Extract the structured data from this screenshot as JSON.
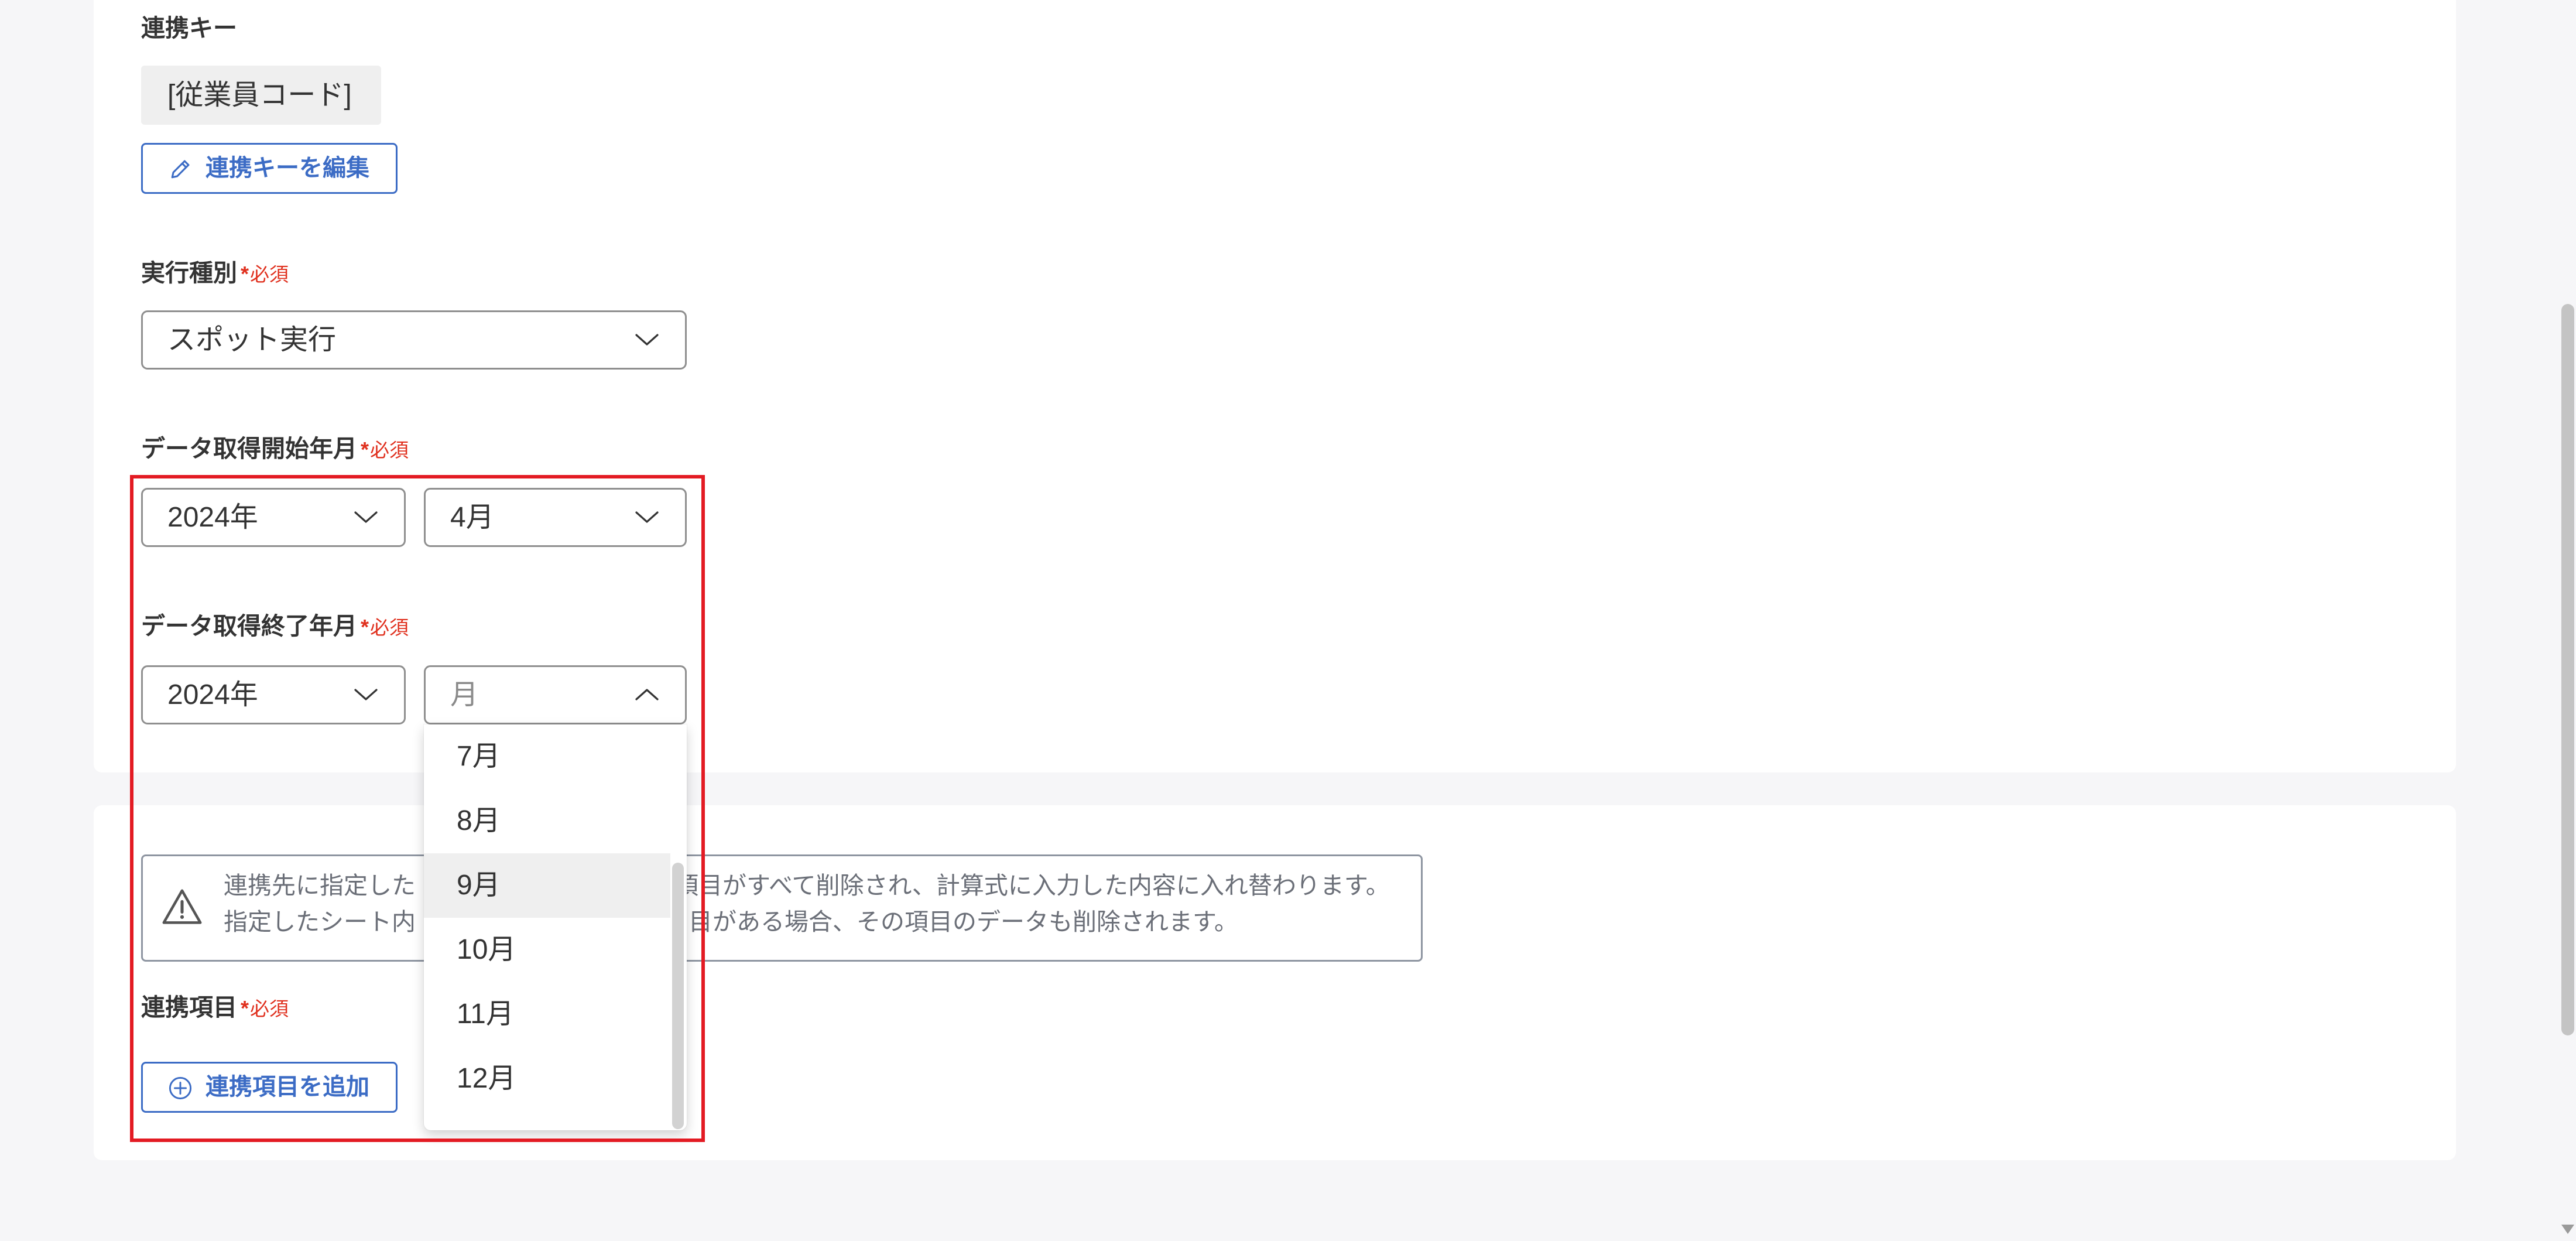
{
  "required": {
    "mark": "*",
    "text": "必須"
  },
  "linkage_key": {
    "label": "連携キー",
    "value": "[従業員コード]",
    "edit_button": "連携キーを編集"
  },
  "execution_type": {
    "label": "実行種別",
    "selected": "スポット実行"
  },
  "start_period": {
    "label": "データ取得開始年月",
    "year": "2024年",
    "month": "4月"
  },
  "end_period": {
    "label": "データ取得終了年月",
    "year": "2024年",
    "month_placeholder": "月",
    "month_dropdown_open": true,
    "month_options": [
      {
        "label": "7月",
        "highlighted": false
      },
      {
        "label": "8月",
        "highlighted": false
      },
      {
        "label": "9月",
        "highlighted": true
      },
      {
        "label": "10月",
        "highlighted": false
      },
      {
        "label": "11月",
        "highlighted": false
      },
      {
        "label": "12月",
        "highlighted": false
      }
    ]
  },
  "warning": {
    "line1_left": "連携先に指定した",
    "line1_right": "項目がすべて削除され、計算式に入力した内容に入れ替わります。",
    "line2_left": "指定したシート内",
    "line2_right": "目がある場合、その項目のデータも削除されます。"
  },
  "linkage_items": {
    "label": "連携項目",
    "add_button": "連携項目を追加"
  },
  "icons": {
    "edit": "pencil-icon",
    "select_closed": "chevron-down-icon",
    "select_open": "chevron-up-icon",
    "warning": "warning-triangle-icon",
    "add": "plus-circle-icon",
    "scroll_down": "triangle-down-icon"
  },
  "colors": {
    "accent": "#3c6cc5",
    "required": "#e0301e",
    "frame": "#e31b23",
    "text": "#333333",
    "muted": "#6b6f78",
    "page_bg": "#f6f6f8"
  }
}
